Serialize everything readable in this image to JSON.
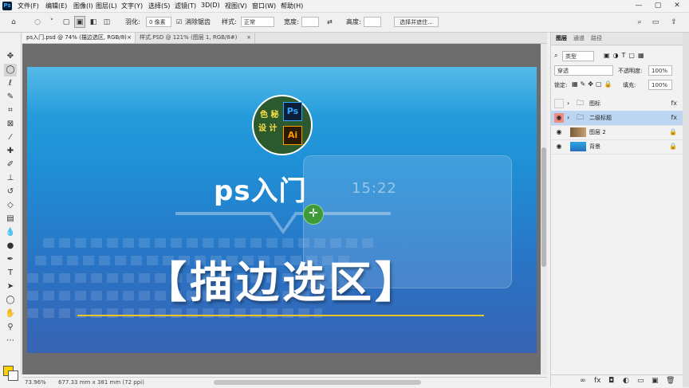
{
  "menubar": {
    "logo": "Ps",
    "items": [
      "文件(F)",
      "编辑(E)",
      "图像(I)",
      "图层(L)",
      "文字(Y)",
      "选择(S)",
      "滤镜(T)",
      "3D(D)",
      "视图(V)",
      "窗口(W)",
      "帮助(H)"
    ],
    "window_controls": [
      "—",
      "▢",
      "✕"
    ]
  },
  "options": {
    "feather_label": "羽化:",
    "feather_value": "0 像素",
    "antialias_label": "消除锯齿",
    "style_label": "样式:",
    "style_value": "正常",
    "width_label": "宽度:",
    "height_label": "高度:",
    "select_mask_label": "选择并遮住..."
  },
  "tabs": [
    {
      "label": "ps入门.psd @ 74% (描边选区, RGB/8)",
      "close": "×"
    },
    {
      "label": "样式.PSD @ 121% (图层 1, RGB/8#)",
      "close": "×"
    }
  ],
  "canvas": {
    "logo_text_line1": "色 秘",
    "logo_text_line2": "设 计",
    "logo_ps": "Ps",
    "logo_ai": "Ai",
    "subtitle": "ps入门",
    "title": "【描边选区】",
    "tablet_time": "15:22",
    "cursor_glyph": "✛"
  },
  "status": {
    "zoom": "73.96%",
    "doc": "677.33 mm x 381 mm (72 ppi)"
  },
  "panel": {
    "tabs": [
      "图层",
      "通道",
      "路径"
    ],
    "filter_label": "类型",
    "blend_mode": "穿透",
    "opacity_label": "不透明度:",
    "opacity_value": "100%",
    "lock_label": "锁定:",
    "fill_label": "填充:",
    "fill_value": "100%",
    "layers": [
      {
        "name": "图标",
        "fx": "fx",
        "visible": false,
        "type": "group"
      },
      {
        "name": "二级标题",
        "fx": "fx",
        "visible": true,
        "type": "group",
        "selected": true
      },
      {
        "name": "图层 2",
        "fx": "",
        "visible": true,
        "type": "image"
      },
      {
        "name": "背景",
        "fx": "",
        "visible": true,
        "type": "background"
      }
    ],
    "bottom_icons": [
      "∞",
      "fx",
      "◘",
      "◐",
      "▭",
      "▣",
      "🗑"
    ]
  },
  "colors": {
    "foreground": "#ffd200",
    "background": "#ffffff",
    "selected_layer": "#bcd6f1"
  }
}
